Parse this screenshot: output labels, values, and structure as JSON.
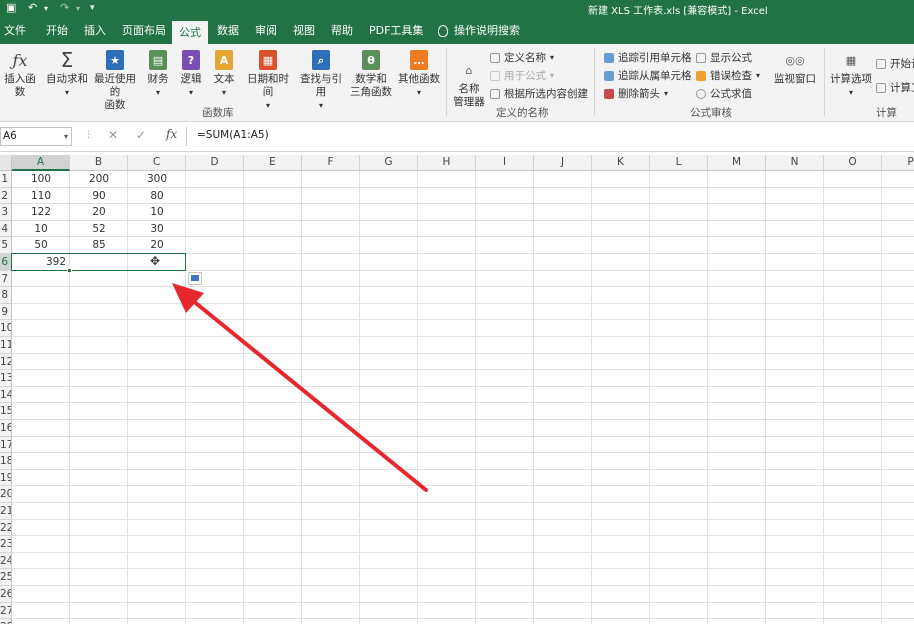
{
  "window": {
    "title": "新建 XLS 工作表.xls  [兼容模式]  -  Excel"
  },
  "tabs": [
    {
      "label": "文件"
    },
    {
      "label": "开始"
    },
    {
      "label": "插入"
    },
    {
      "label": "页面布局"
    },
    {
      "label": "公式",
      "active": true
    },
    {
      "label": "数据"
    },
    {
      "label": "审阅"
    },
    {
      "label": "视图"
    },
    {
      "label": "帮助"
    },
    {
      "label": "PDF工具集"
    }
  ],
  "tell_me": "操作说明搜索",
  "ribbon": {
    "function_library": {
      "group_label": "函数库",
      "buttons": [
        {
          "label": "插入函数",
          "icon": "fx-icon"
        },
        {
          "label": "自动求和",
          "icon": "sigma-icon"
        },
        {
          "label_lines": [
            "最近使用的",
            "函数"
          ],
          "icon": "star-icon"
        },
        {
          "label": "财务",
          "icon": "financial-icon"
        },
        {
          "label": "逻辑",
          "icon": "question-icon"
        },
        {
          "label": "文本",
          "icon": "text-icon"
        },
        {
          "label": "日期和时间",
          "icon": "calendar-icon"
        },
        {
          "label": "查找与引用",
          "icon": "search-icon"
        },
        {
          "label_lines": [
            "数学和",
            "三角函数"
          ],
          "icon": "theta-icon"
        },
        {
          "label": "其他函数",
          "icon": "more-icon"
        }
      ]
    },
    "defined_names": {
      "group_label": "定义的名称",
      "name_manager": [
        "名称",
        "管理器"
      ],
      "define_name": "定义名称",
      "use_in_formula": "用于公式",
      "create_from_selection": "根据所选内容创建"
    },
    "formula_auditing": {
      "group_label": "公式审核",
      "trace_precedents": "追踪引用单元格",
      "trace_dependents": "追踪从属单元格",
      "remove_arrows": "删除箭头",
      "show_formulas": "显示公式",
      "error_checking": "错误检查",
      "evaluate_formula": "公式求值",
      "watch_window": "监视窗口"
    },
    "calculation": {
      "group_label": "计算",
      "calc_options": "计算选项",
      "calc_now": "开始计",
      "calc_sheet": "计算工"
    }
  },
  "formula_bar": {
    "name_box": "A6",
    "cancel": "✕",
    "enter": "✓",
    "fx": "fx",
    "formula": "=SUM(A1:A5)"
  },
  "sheet": {
    "columns": [
      "A",
      "B",
      "C",
      "D",
      "E",
      "F",
      "G",
      "H",
      "I",
      "J",
      "K",
      "L",
      "M",
      "N",
      "O",
      "P"
    ],
    "row_numbers": [
      "1",
      "2",
      "3",
      "4",
      "5",
      "6",
      "7",
      "8",
      "9",
      "10",
      "11",
      "12",
      "13",
      "14",
      "15",
      "16",
      "17",
      "18",
      "19",
      "20",
      "21",
      "22",
      "23",
      "24",
      "25",
      "26",
      "27",
      "28"
    ],
    "rows": [
      [
        "100",
        "200",
        "300"
      ],
      [
        "110",
        "90",
        "80"
      ],
      [
        "122",
        "20",
        "10"
      ],
      [
        "10",
        "52",
        "30"
      ],
      [
        "50",
        "85",
        "20"
      ]
    ],
    "a6_value": "392",
    "selected_column": "A",
    "selected_row": "6"
  },
  "colors": {
    "accent": "#217346",
    "arrow": "#e8262d"
  }
}
